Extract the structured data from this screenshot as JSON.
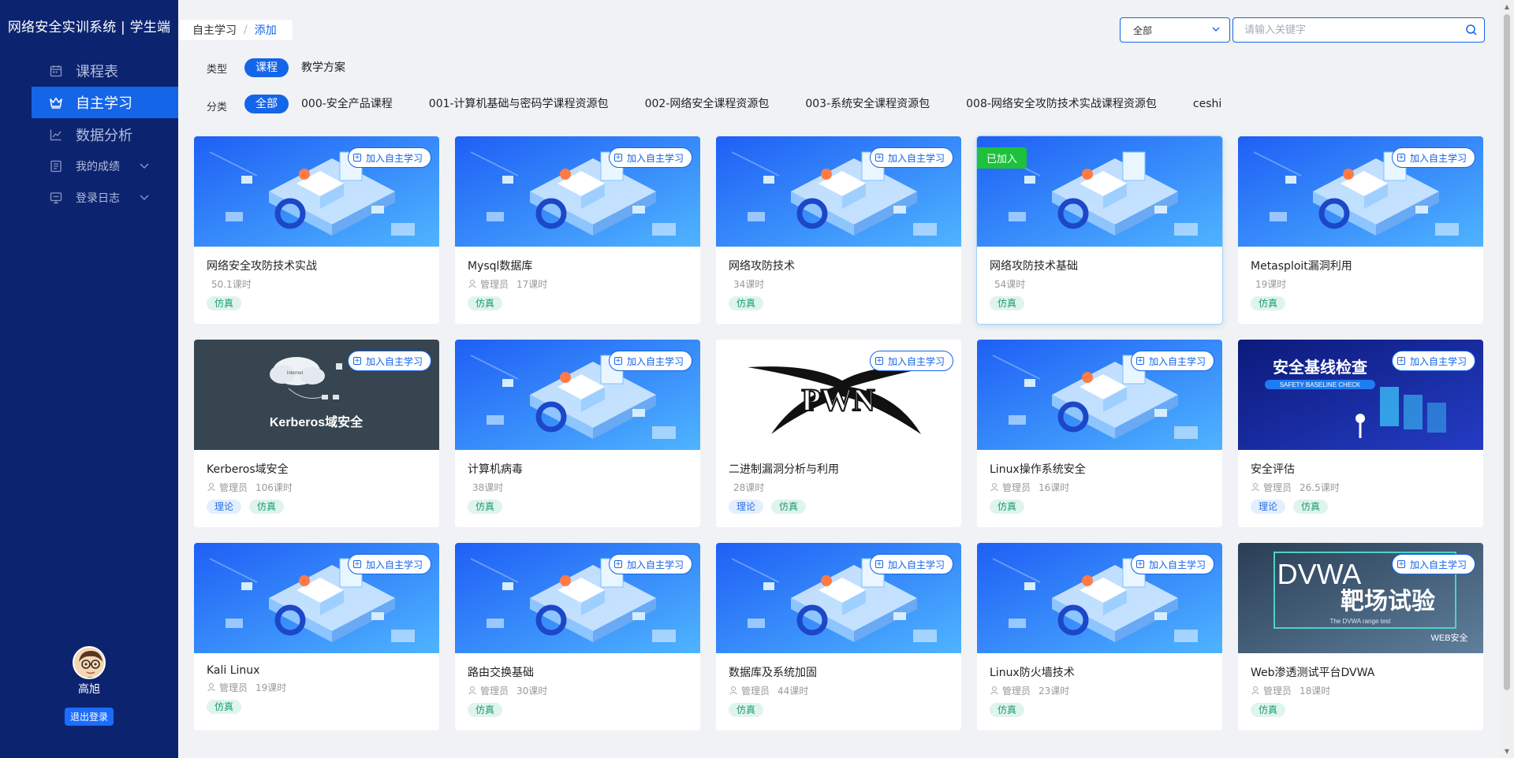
{
  "app": {
    "title": "网络安全实训系统 | 学生端"
  },
  "sidebar": {
    "items": [
      {
        "label": "课程表",
        "icon": "calendar-icon",
        "active": false
      },
      {
        "label": "自主学习",
        "icon": "crown-icon",
        "active": true
      },
      {
        "label": "数据分析",
        "icon": "chart-icon",
        "active": false
      },
      {
        "label": "我的成绩",
        "icon": "score-icon",
        "active": false,
        "expandable": true
      },
      {
        "label": "登录日志",
        "icon": "monitor-icon",
        "active": false,
        "expandable": true
      }
    ],
    "user": {
      "name": "高旭",
      "logout_label": "退出登录"
    }
  },
  "breadcrumb": {
    "parent": "自主学习",
    "separator": "/",
    "current": "添加"
  },
  "search": {
    "select_value": "全部",
    "placeholder": "请输入关键字"
  },
  "filters": {
    "type": {
      "label": "类型",
      "options": [
        "课程",
        "教学方案"
      ],
      "selected": 0
    },
    "category": {
      "label": "分类",
      "options": [
        "全部",
        "000-安全产品课程",
        "001-计算机基础与密码学课程资源包",
        "002-网络安全课程资源包",
        "003-系统安全课程资源包",
        "008-网络安全攻防技术实战课程资源包",
        "ceshi"
      ],
      "selected": 0
    }
  },
  "join_label": "加入自主学习",
  "joined_label": "已加入",
  "courses": [
    {
      "title": "网络安全攻防技术实战",
      "author": "",
      "hours": "50.1课时",
      "tags": [
        "仿真"
      ],
      "cover": "iso",
      "joined": false
    },
    {
      "title": "Mysql数据库",
      "author": "管理员",
      "hours": "17课时",
      "tags": [
        "仿真"
      ],
      "cover": "iso",
      "joined": false
    },
    {
      "title": "网络攻防技术",
      "author": "",
      "hours": "34课时",
      "tags": [
        "仿真"
      ],
      "cover": "iso",
      "joined": false
    },
    {
      "title": "网络攻防技术基础",
      "author": "",
      "hours": "54课时",
      "tags": [
        "仿真"
      ],
      "cover": "iso",
      "joined": true
    },
    {
      "title": "Metasploit漏洞利用",
      "author": "",
      "hours": "19课时",
      "tags": [
        "仿真"
      ],
      "cover": "iso",
      "joined": false
    },
    {
      "title": "Kerberos域安全",
      "author": "管理员",
      "hours": "106课时",
      "tags": [
        "理论",
        "仿真"
      ],
      "cover": "kerberos",
      "cover_text": "Kerberos域安全",
      "cover_sub": "Internet",
      "joined": false
    },
    {
      "title": "计算机病毒",
      "author": "",
      "hours": "38课时",
      "tags": [
        "仿真"
      ],
      "cover": "iso",
      "joined": false
    },
    {
      "title": "二进制漏洞分析与利用",
      "author": "",
      "hours": "28课时",
      "tags": [
        "理论",
        "仿真"
      ],
      "cover": "pwn",
      "cover_text": "PWN",
      "joined": false
    },
    {
      "title": "Linux操作系统安全",
      "author": "管理员",
      "hours": "16课时",
      "tags": [
        "仿真"
      ],
      "cover": "iso",
      "joined": false
    },
    {
      "title": "安全评估",
      "author": "管理员",
      "hours": "26.5课时",
      "tags": [
        "理论",
        "仿真"
      ],
      "cover": "baseline",
      "cover_text": "安全基线检查",
      "cover_sub": "SAFETY BASELINE CHECK",
      "joined": false
    },
    {
      "title": "Kali Linux",
      "author": "管理员",
      "hours": "19课时",
      "tags": [
        "仿真"
      ],
      "cover": "iso",
      "joined": false
    },
    {
      "title": "路由交换基础",
      "author": "管理员",
      "hours": "30课时",
      "tags": [
        "仿真"
      ],
      "cover": "iso",
      "joined": false
    },
    {
      "title": "数据库及系统加固",
      "author": "管理员",
      "hours": "44课时",
      "tags": [
        "仿真"
      ],
      "cover": "iso",
      "joined": false
    },
    {
      "title": "Linux防火墙技术",
      "author": "管理员",
      "hours": "23课时",
      "tags": [
        "仿真"
      ],
      "cover": "iso",
      "joined": false
    },
    {
      "title": "Web渗透测试平台DVWA",
      "author": "管理员",
      "hours": "18课时",
      "tags": [
        "仿真"
      ],
      "cover": "dvwa",
      "cover_text": "DVWA",
      "cover_text2": "靶场试验",
      "cover_sub": "The DVWA range test",
      "cover_sub2": "WEB安全",
      "joined": false
    }
  ],
  "colors": {
    "sidebar_bg": "#0c2470",
    "accent": "#1565e8",
    "joined": "#1ec13b",
    "tag_sim": "#1a9d6e",
    "tag_theory": "#2a6ee0"
  }
}
